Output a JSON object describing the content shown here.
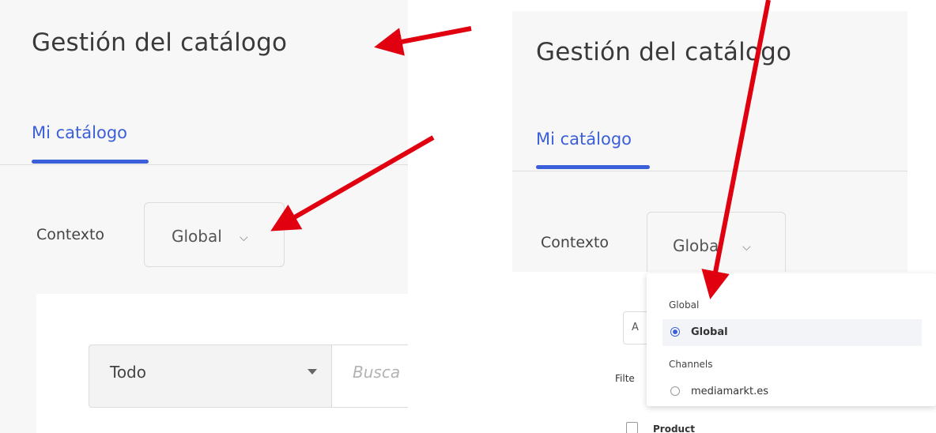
{
  "left_panel": {
    "title": "Gestión del catálogo",
    "tab_label": "Mi catálogo",
    "context_label": "Contexto",
    "context_value": "Global",
    "filter_select_value": "Todo",
    "search_placeholder": "Busca"
  },
  "right_panel": {
    "title": "Gestión del catálogo",
    "tab_label": "Mi catálogo",
    "context_label": "Contexto",
    "context_value": "Global"
  },
  "background_content": {
    "input_partial": "A",
    "filter_partial": "Filte",
    "checkbox_label": "Product"
  },
  "dropdown": {
    "group_global": "Global",
    "option_global": "Global",
    "group_channels": "Channels",
    "option_channel": "mediamarkt.es",
    "selected": "Global"
  },
  "icons": {
    "chevron": "chevron-down-icon",
    "caret": "caret-down-icon",
    "radio": "radio-icon"
  },
  "colors": {
    "accent": "#3b5fd9",
    "annotation_arrow": "#e0000f"
  }
}
